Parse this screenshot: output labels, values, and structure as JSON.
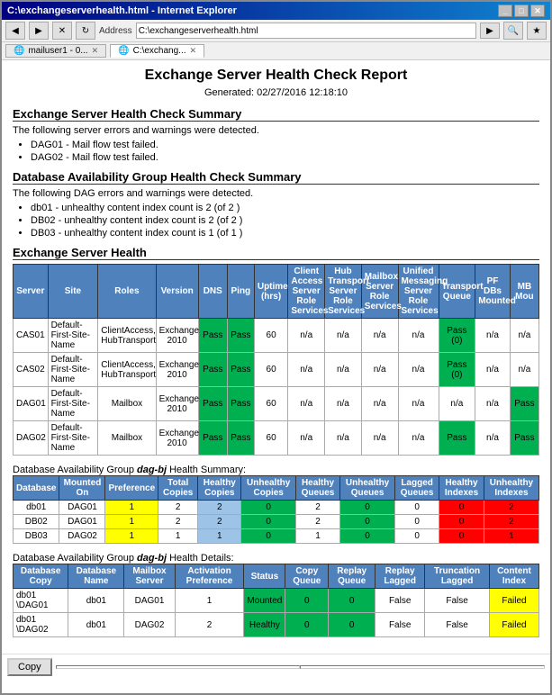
{
  "window": {
    "title": "C:\\exchangeserverhealth.html - Internet Explorer",
    "address": "C:\\exchangeserverhealth.html",
    "tab1_label": "mailuser1 - 0...",
    "tab2_label": "C:\\exchang...",
    "tab1_icon": "🌐",
    "tab2_icon": "🌐"
  },
  "report": {
    "title": "Exchange Server Health Check Report",
    "generated": "Generated: 02/27/2016 12:18:10",
    "summary_title": "Exchange Server Health Check Summary",
    "summary_desc": "The following server errors and warnings were detected.",
    "summary_bullets": [
      "DAG01 - Mail flow test failed.",
      "DAG02 - Mail flow test failed."
    ],
    "dag_summary_title": "Database Availability Group Health Check Summary",
    "dag_summary_desc": "The following DAG errors and warnings were detected.",
    "dag_summary_bullets": [
      "db01 - unhealthy content index count is 2 (of 2 )",
      "DB02 - unhealthy content index count is 2 (of 2 )",
      "DB03 - unhealthy content index count is 1 (of 1 )"
    ],
    "exchange_health_title": "Exchange Server Health",
    "exchange_table_headers": [
      "Server",
      "Site",
      "Roles",
      "Version",
      "DNS",
      "Ping",
      "Uptime (hrs)",
      "Client Access Server Role Services",
      "Hub Transport Server Role Services",
      "Mailbox Server Role Services",
      "Unified Messaging Server Role Services",
      "Transport Queue",
      "PF DBs Mounted",
      "MB Mou"
    ],
    "exchange_rows": [
      {
        "server": "CAS01",
        "site": "Default-First-Site-Name",
        "roles": "ClientAccess, HubTransport",
        "version": "Exchange 2010",
        "dns": "Pass",
        "ping": "Pass",
        "uptime": "60",
        "cas": "n/a",
        "hub": "n/a",
        "mailbox": "n/a",
        "um": "n/a",
        "transport": "Pass (0)",
        "pfdb": "n/a",
        "mb": "n/a"
      },
      {
        "server": "CAS02",
        "site": "Default-First-Site-Name",
        "roles": "ClientAccess, HubTransport",
        "version": "Exchange 2010",
        "dns": "Pass",
        "ping": "Pass",
        "uptime": "60",
        "cas": "n/a",
        "hub": "n/a",
        "mailbox": "n/a",
        "um": "n/a",
        "transport": "Pass (0)",
        "pfdb": "n/a",
        "mb": "n/a"
      },
      {
        "server": "DAG01",
        "site": "Default-First-Site-Name",
        "roles": "Mailbox",
        "version": "Exchange 2010",
        "dns": "Pass",
        "ping": "Pass",
        "uptime": "60",
        "cas": "n/a",
        "hub": "n/a",
        "mailbox": "n/a",
        "um": "n/a",
        "transport": "n/a",
        "pfdb": "n/a",
        "mb": "Pass"
      },
      {
        "server": "DAG02",
        "site": "Default-First-Site-Name",
        "roles": "Mailbox",
        "version": "Exchange 2010",
        "dns": "Pass",
        "ping": "Pass",
        "uptime": "60",
        "cas": "n/a",
        "hub": "n/a",
        "mailbox": "n/a",
        "um": "n/a",
        "transport": "Pass",
        "pfdb": "n/a",
        "mb": "Pass"
      }
    ],
    "dag_health_label": "Database Availability Group",
    "dag_name": "dag-bj",
    "dag_health_suffix": "Health Summary:",
    "dag_summary_headers": [
      "Database",
      "Mounted On",
      "Preference",
      "Total Copies",
      "Healthy Copies",
      "Unhealthy Copies",
      "Healthy Queues",
      "Unhealthy Queues",
      "Lagged Queues",
      "Healthy Indexes",
      "Unhealthy Indexes"
    ],
    "dag_summary_rows": [
      {
        "db": "db01",
        "mounted": "DAG01",
        "pref": "1",
        "total": "2",
        "healthy": "2",
        "unhealthy": "0",
        "hq": "2",
        "uq": "0",
        "lagged": "0",
        "hi": "0",
        "ui": "2"
      },
      {
        "db": "DB02",
        "mounted": "DAG01",
        "pref": "1",
        "total": "2",
        "healthy": "2",
        "unhealthy": "0",
        "hq": "2",
        "uq": "0",
        "lagged": "0",
        "hi": "0",
        "ui": "2"
      },
      {
        "db": "DB03",
        "mounted": "DAG02",
        "pref": "1",
        "total": "1",
        "healthy": "1",
        "unhealthy": "0",
        "hq": "1",
        "uq": "0",
        "lagged": "0",
        "hi": "0",
        "ui": "1"
      }
    ],
    "dag_detail_label": "Database Availability Group",
    "dag_detail_suffix": "Health Details:",
    "dag_detail_headers": [
      "Database Copy",
      "Database Name",
      "Mailbox Server",
      "Activation Preference",
      "Status",
      "Copy Queue",
      "Replay Queue",
      "Replay Lagged",
      "Truncation Lagged",
      "Content Index"
    ],
    "dag_detail_rows": [
      {
        "copy": "db01 \\DAG01",
        "name": "db01",
        "server": "DAG01",
        "pref": "1",
        "status": "Mounted",
        "cq": "0",
        "rq": "0",
        "rl": "False",
        "tl": "False",
        "ci": "Failed"
      },
      {
        "copy": "db01 \\DAG02",
        "name": "db01",
        "server": "DAG02",
        "pref": "2",
        "status": "Healthy",
        "cq": "0",
        "rq": "0",
        "rl": "False",
        "tl": "False",
        "ci": "Failed"
      }
    ]
  },
  "bottom": {
    "copy_label": "Copy",
    "status1": "",
    "status2": ""
  }
}
